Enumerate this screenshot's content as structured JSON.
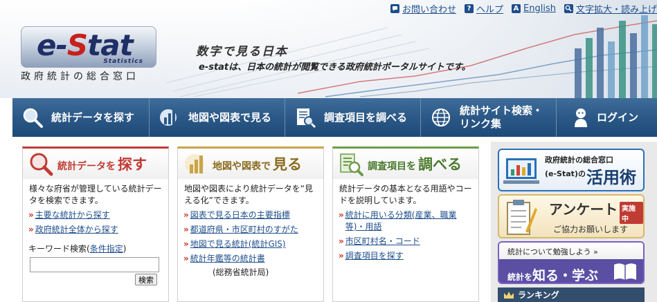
{
  "utility_nav": [
    {
      "label": "お問い合わせ",
      "icon": "chat-icon"
    },
    {
      "label": "ヘルプ",
      "icon": "help-icon"
    },
    {
      "label": "English",
      "icon": "english-icon"
    },
    {
      "label": "文字拡大・読み上げ",
      "icon": "magnifier-icon"
    }
  ],
  "logo": {
    "main_prefix": "e-",
    "main_s": "S",
    "main_suffix": "tat",
    "statistics": "Statistics",
    "subtitle": "政府統計の総合窓口"
  },
  "tagline": {
    "title": "数字で見る日本",
    "text": "e-statは、日本の統計が閲覧できる政府統計ポータルサイトです。"
  },
  "main_nav": [
    {
      "label": "統計データを探す",
      "icon": "search-icon"
    },
    {
      "label": "地図や図表で見る",
      "icon": "chart-icon"
    },
    {
      "label": "調査項目を調べる",
      "icon": "document-search-icon"
    },
    {
      "label_line1": "統計サイト検索・",
      "label_line2": "リンク集",
      "icon": "globe-icon"
    },
    {
      "label": "ログイン",
      "icon": "user-icon"
    }
  ],
  "panels": {
    "search": {
      "title_small": "統計データを",
      "title_big": "探す",
      "accent": "#c03b33",
      "description": "様々な府省が管理している統計データを検索できます。",
      "links": [
        "主要な統計から探す",
        "政府統計全体から探す"
      ],
      "keyword_label": "キーワード検索(",
      "keyword_link": "条件指定",
      "keyword_label_end": ")",
      "search_button": "検索",
      "search_value": ""
    },
    "view": {
      "title_small": "地図や図表で",
      "title_big": "見る",
      "accent": "#c9a44a",
      "description": "地図や図表により統計データを“見える化”できます。",
      "links": [
        "図表で見る日本の主要指標",
        "都道府県・市区町村のすがた",
        "地図で見る統計(統計GIS)",
        "統計年鑑等の統計書"
      ],
      "links_note": "(総務省統計局)"
    },
    "survey": {
      "title_small": "調査項目を",
      "title_big": "調べる",
      "accent": "#6c9a4a",
      "description": "統計データの基本となる用語やコードを説明しています。",
      "links": [
        "統計に用いる分類(産業、職業等)・用語",
        "市区町村名・コード",
        "調査項目を探す"
      ]
    }
  },
  "sidebar": {
    "banner1": {
      "line1": "政府統計の総合窓口",
      "line2": "(e-Stat)の",
      "big": "活用術"
    },
    "banner2": {
      "title": "アンケート",
      "badge": "実施中",
      "sub": "ご協力お願いします"
    },
    "banner3": {
      "top": "統計について勉強しよう »",
      "prefix": "統計を",
      "big": "知る・学ぶ"
    },
    "ranking": "ランキング"
  },
  "colors": {
    "nav_blue": "#2b5886",
    "link_blue": "#1e4e8c",
    "bullet_red": "#d03020"
  }
}
